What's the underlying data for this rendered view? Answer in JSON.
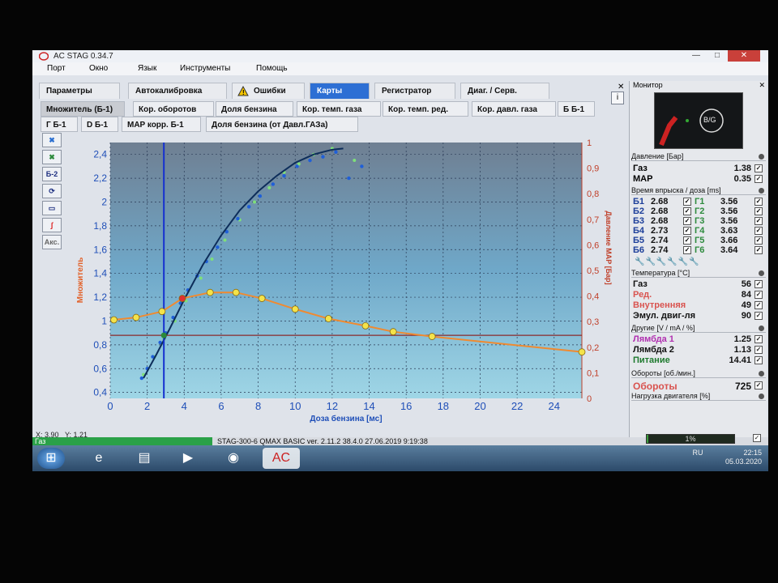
{
  "window": {
    "title": "AC STAG 0.34.7"
  },
  "menu": [
    "Порт",
    "Окно",
    "Язык",
    "Инструменты",
    "Помощь"
  ],
  "main_tabs": [
    {
      "label": "Параметры"
    },
    {
      "label": "Автокалибровка"
    },
    {
      "label": "Ошибки"
    },
    {
      "label": "Карты"
    },
    {
      "label": "Регистратор"
    },
    {
      "label": "Диаг. / Серв."
    }
  ],
  "sub_tabs_row1": [
    {
      "label": "Множитель (Б-1)"
    },
    {
      "label": "Кор. оборотов"
    },
    {
      "label": "Доля бензина"
    },
    {
      "label": "Кор. темп. газа"
    },
    {
      "label": "Кор. темп. ред."
    },
    {
      "label": "Кор. давл. газа"
    },
    {
      "label": "Б Б-1"
    }
  ],
  "sub_tabs_row2": [
    {
      "label": "Г Б-1"
    },
    {
      "label": "D Б-1"
    },
    {
      "label": "MAP корр. Б-1"
    },
    {
      "label": "Доля бензина (от Давл.ГАЗа)"
    }
  ],
  "toolbar": {
    "b2_label": "Б-2",
    "aks_label": "Акс."
  },
  "cursor_readout": {
    "x_label": "X: 3,90",
    "y_label": "Y: 1,21"
  },
  "status": {
    "fuel": "Газ",
    "version_line": "STAG-300-6 QMAX BASIC  ver. 2.11.2  38.4.0  27.06.2019 9:19:38"
  },
  "tray": {
    "lang": "RU",
    "time": "22:15",
    "date": "05.03.2020"
  },
  "monitor": {
    "title": "Монитор",
    "gauge_label": "B/G",
    "pressure_header": "Давление [Бар]",
    "pressure": [
      {
        "label": "Газ",
        "value": "1.38"
      },
      {
        "label": "MAP",
        "value": "0.35"
      }
    ],
    "injection_header": "Время впрыска / доза [ms]",
    "injection": [
      {
        "b": "Б1",
        "bv": "2.68",
        "g": "Г1",
        "gv": "3.56"
      },
      {
        "b": "Б2",
        "bv": "2.68",
        "g": "Г2",
        "gv": "3.56"
      },
      {
        "b": "Б3",
        "bv": "2.68",
        "g": "Г3",
        "gv": "3.56"
      },
      {
        "b": "Б4",
        "bv": "2.73",
        "g": "Г4",
        "gv": "3.63"
      },
      {
        "b": "Б5",
        "bv": "2.74",
        "g": "Г5",
        "gv": "3.66"
      },
      {
        "b": "Б6",
        "bv": "2.74",
        "g": "Г6",
        "gv": "3.64"
      }
    ],
    "temp_header": "Температура [°C]",
    "temps": [
      {
        "label": "Газ",
        "value": "56",
        "color": "#111111"
      },
      {
        "label": "Ред.",
        "value": "84",
        "color": "#d9534f"
      },
      {
        "label": "Внутренняя",
        "value": "49",
        "color": "#d9534f"
      },
      {
        "label": "Эмул. двиг-ля",
        "value": "90",
        "color": "#111111"
      }
    ],
    "other_header": "Другие [V / mA / %]",
    "others": [
      {
        "label": "Лямбда 1",
        "value": "1.25",
        "color": "#b030b0"
      },
      {
        "label": "Лямбда 2",
        "value": "1.13",
        "color": "#111111"
      },
      {
        "label": "Питание",
        "value": "14.41",
        "color": "#1f7a2f"
      }
    ],
    "rpm_header": "Обороты [об./мин.]",
    "rpm": {
      "label": "Обороты",
      "value": "725",
      "color": "#d9534f"
    },
    "load_header": "Нагрузка двигателя [%]",
    "load": {
      "label": "1%",
      "value": 1
    }
  },
  "chart_data": {
    "type": "scatter",
    "xlabel": "Доза бензина [мс]",
    "ylabel": "Множитель",
    "y2label": "Давление MAP [Бар]",
    "xlim": [
      0,
      25.5
    ],
    "ylim": [
      0.35,
      2.5
    ],
    "y2lim": [
      0,
      1
    ],
    "xticks": [
      "0",
      "2",
      "4",
      "6",
      "8",
      "10",
      "12",
      "14",
      "16",
      "18",
      "20",
      "22",
      "24"
    ],
    "yticks": [
      "0,4",
      "0,6",
      "0,8",
      "1",
      "1,2",
      "1,4",
      "1,6",
      "1,8",
      "2",
      "2,2",
      "2,4"
    ],
    "y2ticks": [
      "0",
      "0,1",
      "0,2",
      "0,3",
      "0,4",
      "0,5",
      "0,6",
      "0,7",
      "0,8",
      "0,9",
      "1"
    ],
    "multiplier_curve": {
      "x": [
        0.2,
        1.4,
        2.8,
        3.9,
        5.4,
        6.8,
        8.2,
        10.0,
        11.8,
        13.8,
        15.3,
        17.4,
        25.5
      ],
      "y": [
        1.01,
        1.03,
        1.08,
        1.19,
        1.24,
        1.24,
        1.19,
        1.1,
        1.02,
        0.96,
        0.91,
        0.87,
        0.74
      ]
    },
    "vline_x": 2.9,
    "hline_y": 0.88,
    "trend": {
      "x": [
        1.8,
        2.5,
        3.2,
        4.0,
        5.0,
        6.0,
        7.0,
        8.0,
        9.0,
        10.0,
        11.0,
        12.0,
        12.6
      ],
      "y": [
        0.52,
        0.72,
        0.93,
        1.18,
        1.47,
        1.72,
        1.93,
        2.09,
        2.22,
        2.33,
        2.4,
        2.44,
        2.45
      ]
    },
    "points_blue": {
      "x": [
        1.7,
        2.0,
        2.3,
        2.7,
        3.0,
        3.4,
        3.8,
        4.2,
        4.7,
        5.2,
        5.8,
        6.3,
        6.9,
        7.5,
        8.1,
        8.8,
        9.4,
        10.1,
        10.8,
        11.5,
        12.2,
        12.9,
        13.6
      ],
      "y": [
        0.52,
        0.6,
        0.7,
        0.82,
        0.9,
        1.03,
        1.15,
        1.26,
        1.38,
        1.5,
        1.62,
        1.75,
        1.86,
        1.96,
        2.05,
        2.15,
        2.22,
        2.3,
        2.35,
        2.38,
        2.42,
        2.2,
        2.3
      ]
    },
    "points_green": {
      "x": [
        1.8,
        2.4,
        2.9,
        3.5,
        4.1,
        4.9,
        5.5,
        6.2,
        7.0,
        7.8,
        8.6,
        9.4,
        10.2,
        11.0,
        12.0,
        13.2
      ],
      "y": [
        0.55,
        0.7,
        0.85,
        1.0,
        1.17,
        1.36,
        1.52,
        1.68,
        1.85,
        2.0,
        2.12,
        2.25,
        2.32,
        2.4,
        2.45,
        2.35
      ]
    }
  }
}
